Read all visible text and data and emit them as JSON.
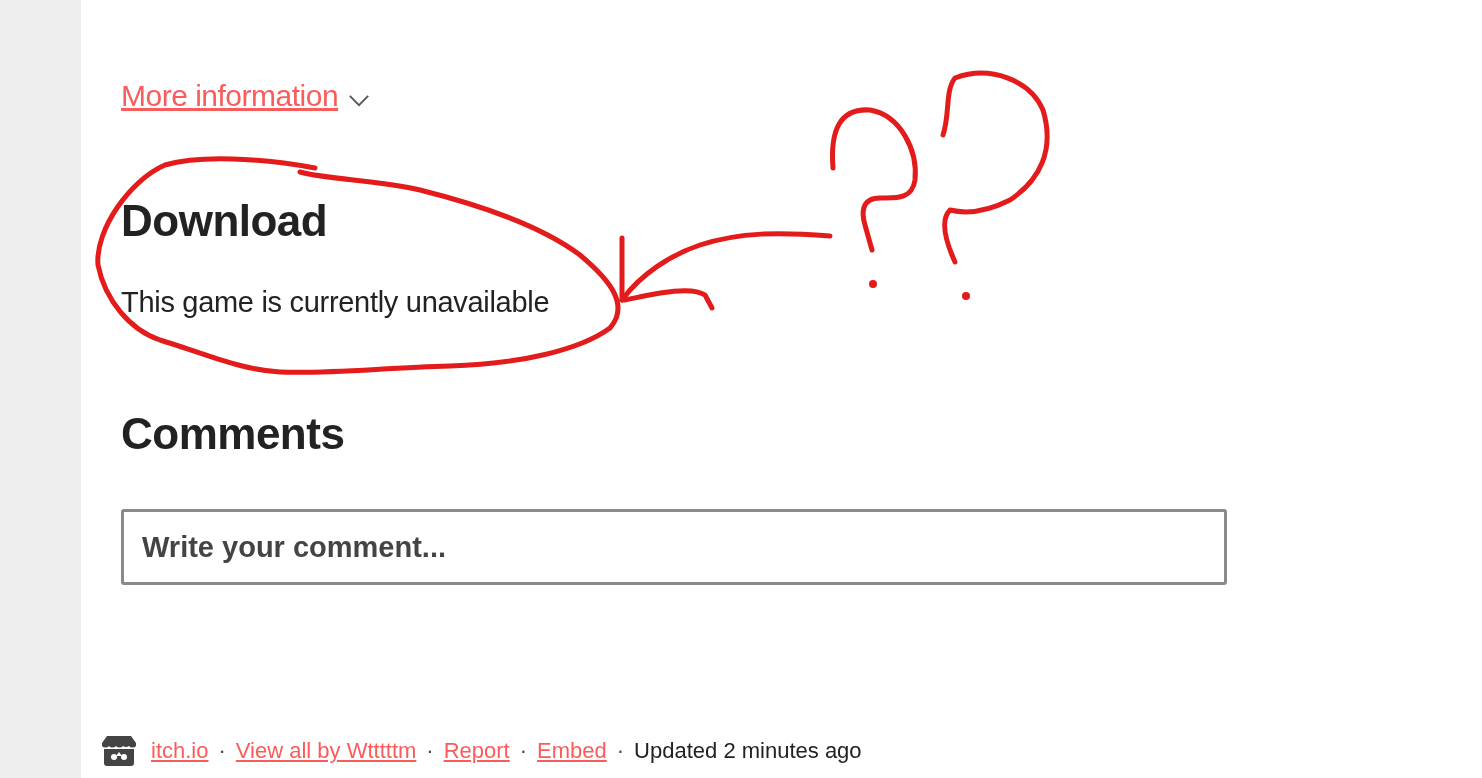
{
  "more_info": {
    "label": "More information",
    "expanded": false
  },
  "download": {
    "heading": "Download",
    "message": "This game is currently unavailable"
  },
  "comments": {
    "heading": "Comments",
    "placeholder": "Write your comment..."
  },
  "footer": {
    "separator": "·",
    "links": [
      {
        "label": "itch.io"
      },
      {
        "label": "View all by Wtttttm"
      },
      {
        "label": "Report"
      },
      {
        "label": "Embed"
      }
    ],
    "updated": "Updated 2 minutes ago"
  },
  "annotation": {
    "kind": "scribble"
  }
}
